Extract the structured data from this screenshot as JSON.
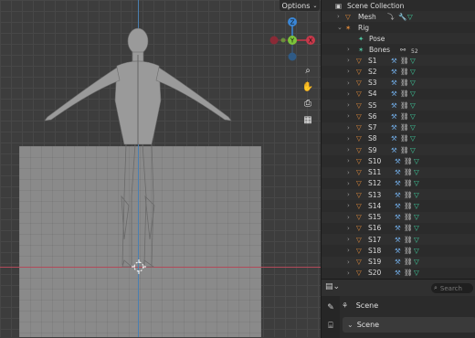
{
  "viewport": {
    "options_label": "Options",
    "gizmo": {
      "z": "Z",
      "y": "Y",
      "x": "X"
    }
  },
  "outliner": {
    "scene_collection": "Scene Collection",
    "mesh": "Mesh",
    "rig": "Rig",
    "pose": "Pose",
    "bones": "Bones",
    "bones_count": "52",
    "items": [
      "S1",
      "S2",
      "S3",
      "S4",
      "S5",
      "S6",
      "S7",
      "S8",
      "S9",
      "S10",
      "S11",
      "S12",
      "S13",
      "S14",
      "S15",
      "S16",
      "S17",
      "S18",
      "S19",
      "S20"
    ]
  },
  "properties": {
    "search_placeholder": "Search",
    "scene_label": "Scene",
    "panel_label": "Scene"
  },
  "colors": {
    "accent_orange": "#e08a3a",
    "mesh_green": "#3fd0a0",
    "bone_green": "#4fc5a0",
    "axis_red": "#c8384a",
    "axis_green": "#7cc43a",
    "axis_blue": "#3a86d6"
  }
}
